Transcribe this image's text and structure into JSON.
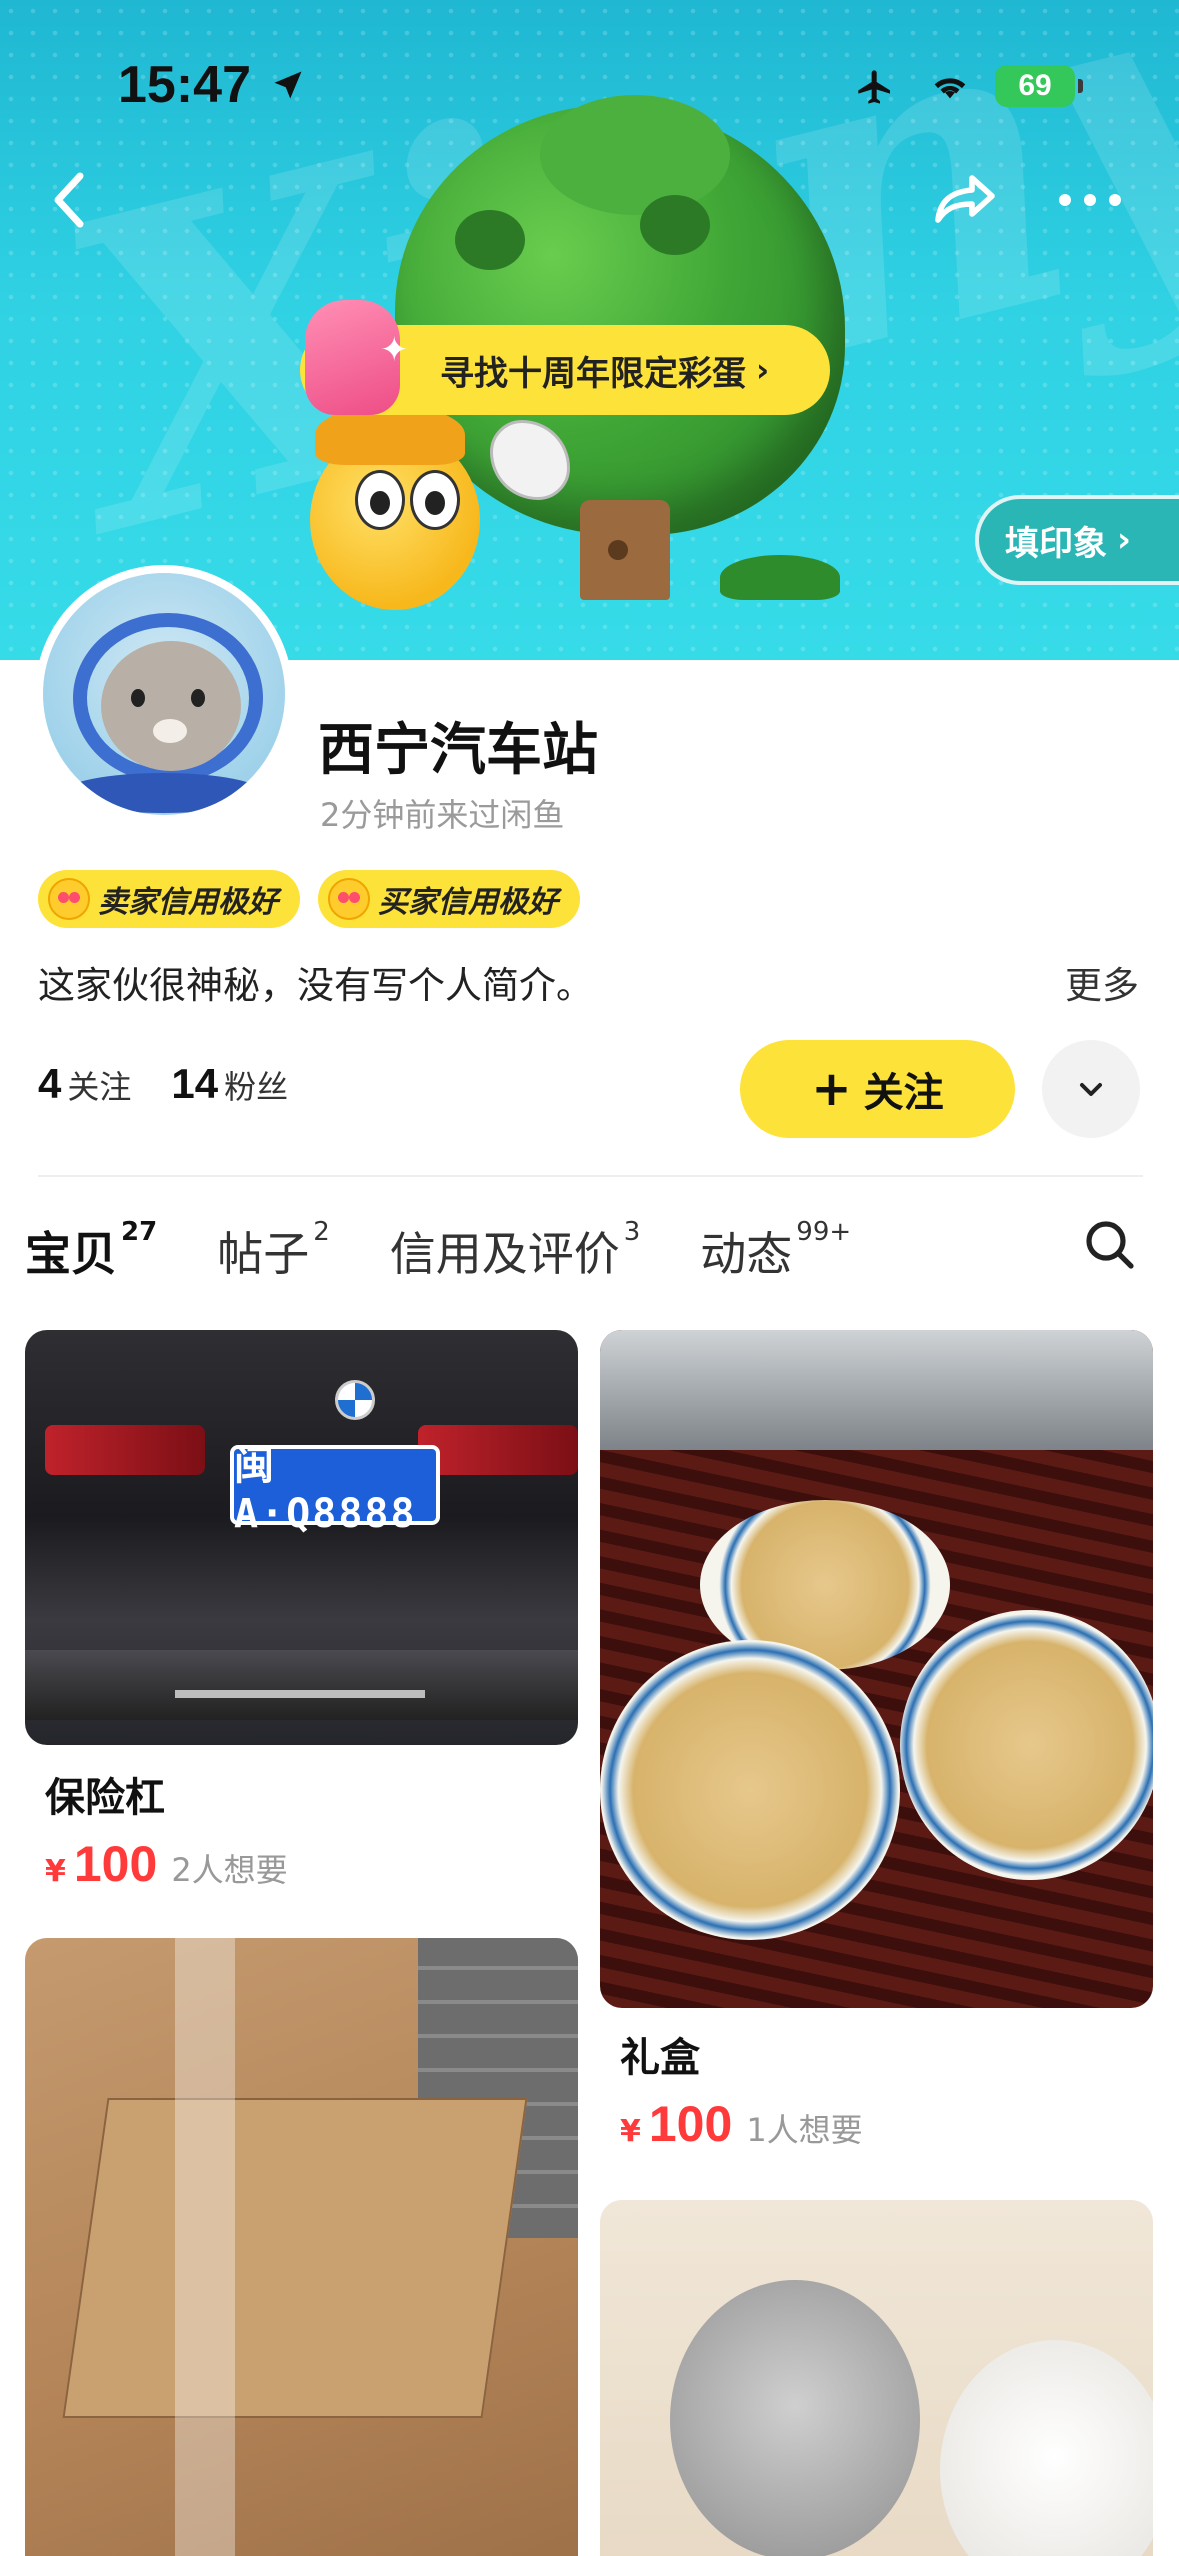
{
  "status_bar": {
    "time": "15:47",
    "battery": "69"
  },
  "banner": {
    "watermark": "Xianyu",
    "egg_label": "寻找十周年限定彩蛋",
    "egg_chevron": "›",
    "stamp_label": "填印象",
    "stamp_chevron": "›"
  },
  "profile": {
    "name": "西宁汽车站",
    "last_seen": "2分钟前来过闲鱼",
    "badges": [
      "卖家信用极好",
      "买家信用极好"
    ],
    "bio": "这家伙很神秘，没有写个人简介。",
    "bio_more": "更多",
    "following_count": "4",
    "following_label": "关注",
    "followers_count": "14",
    "followers_label": "粉丝",
    "follow_button": "关注",
    "follow_plus": "+"
  },
  "tabs": [
    {
      "label": "宝贝",
      "count": "27"
    },
    {
      "label": "帖子",
      "count": "2"
    },
    {
      "label": "信用及评价",
      "count": "3"
    },
    {
      "label": "动态",
      "count": "99+"
    }
  ],
  "products": [
    {
      "title": "保险杠",
      "currency": "¥",
      "price": "100",
      "wanted": "2人想要",
      "plate_text": "闽A·Q8888"
    },
    {
      "title": "礼盒",
      "currency": "¥",
      "price": "100",
      "wanted": "1人想要"
    }
  ],
  "colors": {
    "accent_yellow": "#fde23a",
    "price_red": "#ff3a3a",
    "banner_teal": "#2fd1e3"
  }
}
